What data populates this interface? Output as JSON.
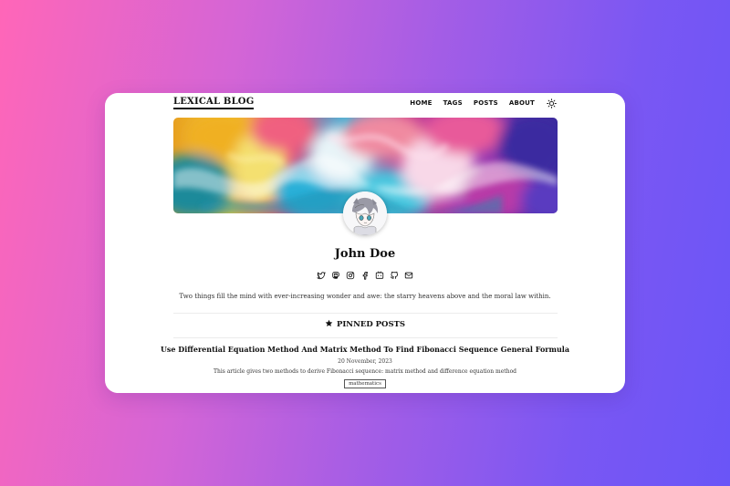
{
  "site": {
    "logo": "LEXICAL BLOG"
  },
  "nav": {
    "items": [
      {
        "label": "HOME"
      },
      {
        "label": "TAGS"
      },
      {
        "label": "POSTS"
      },
      {
        "label": "ABOUT"
      }
    ],
    "theme_icon": "sun-icon"
  },
  "profile": {
    "name": "John Doe",
    "bio": "Two things fill the mind with ever-increasing wonder and awe: the starry heavens above and the moral law within.",
    "socials": [
      {
        "icon": "twitter-icon"
      },
      {
        "icon": "mastodon-icon"
      },
      {
        "icon": "instagram-icon"
      },
      {
        "icon": "facebook-icon"
      },
      {
        "icon": "bilibili-icon"
      },
      {
        "icon": "github-icon"
      },
      {
        "icon": "email-icon"
      }
    ]
  },
  "pinned": {
    "heading": "PINNED POSTS",
    "icon": "star-icon",
    "posts": [
      {
        "title": "Use Differential Equation Method And Matrix Method To Find Fibonacci Sequence General Formula",
        "date": "20 November, 2023",
        "excerpt": "This article gives two methods to derive Fibonacci sequence: matrix method and difference equation method",
        "tag": "mathematics"
      }
    ]
  },
  "colors": {
    "background_start": "#ff66b8",
    "background_end": "#6a55f7",
    "card": "#ffffff",
    "text": "#111111"
  }
}
